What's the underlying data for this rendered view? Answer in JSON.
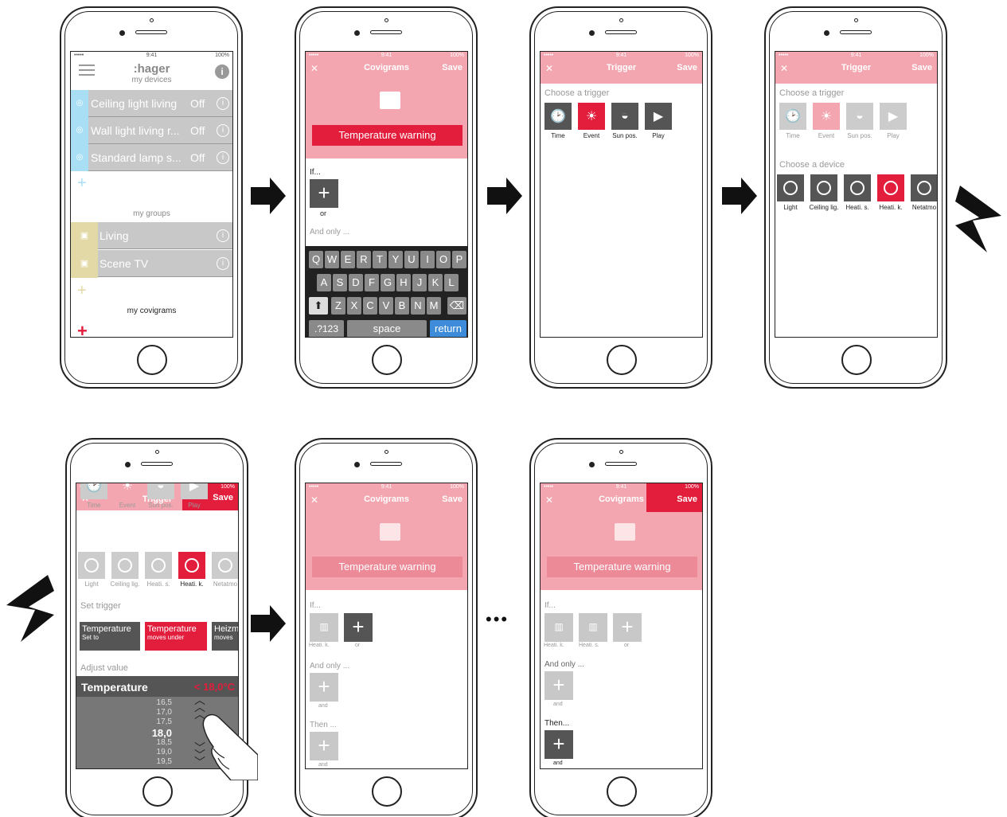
{
  "status": {
    "signal": "••••• ",
    "time": "9:41",
    "battery": "100%"
  },
  "phone1": {
    "logo": ":hager",
    "devices_title": "my devices",
    "devices": [
      {
        "label": "Ceiling light living",
        "state": "Off"
      },
      {
        "label": "Wall light living r...",
        "state": "Off"
      },
      {
        "label": "Standard lamp s...",
        "state": "Off"
      }
    ],
    "groups_title": "my groups",
    "groups": [
      {
        "label": "Living"
      },
      {
        "label": "Scene TV"
      }
    ],
    "covigrams_title": "my covigrams"
  },
  "phone2": {
    "title": "Covigrams",
    "save": "Save",
    "warning": "Temperature warning",
    "if": "If...",
    "or": "or",
    "and_only": "And only ...",
    "keys_row1": [
      "Q",
      "W",
      "E",
      "R",
      "T",
      "Y",
      "U",
      "I",
      "O",
      "P"
    ],
    "keys_row2": [
      "A",
      "S",
      "D",
      "F",
      "G",
      "H",
      "J",
      "K",
      "L"
    ],
    "keys_row3": [
      "Z",
      "X",
      "C",
      "V",
      "B",
      "N",
      "M"
    ],
    "k_num": ".?123",
    "k_space": "space",
    "k_return": "return"
  },
  "phone3": {
    "title": "Trigger",
    "save": "Save",
    "choose": "Choose a trigger",
    "triggers": [
      "Time",
      "Event",
      "Sun pos.",
      "Play"
    ]
  },
  "phone4": {
    "title": "Trigger",
    "save": "Save",
    "choose": "Choose a trigger",
    "triggers": [
      "Time",
      "Event",
      "Sun pos.",
      "Play"
    ],
    "choose_device": "Choose a device",
    "devices": [
      "Light",
      "Ceiling lig.",
      "Heati. s.",
      "Heati. k.",
      "Netatmo"
    ]
  },
  "phone5": {
    "title": "Trigger",
    "save": "Save",
    "triggers": [
      "Time",
      "Event",
      "Sun pos.",
      "Play"
    ],
    "devices": [
      "Light",
      "Ceiling lig.",
      "Heati. s.",
      "Heati. k.",
      "Netatmo"
    ],
    "set_trigger": "Set trigger",
    "opt1_t": "Temperature",
    "opt1_s": "Set to",
    "opt2_t": "Temperature",
    "opt2_s": "moves under",
    "opt3_t": "Heizm",
    "opt3_s": "moves",
    "adjust": "Adjust value",
    "temp_label": "Temperature",
    "temp_value": "< 18,0°C",
    "values": [
      "16,5",
      "17,0",
      "17,5",
      "18,0",
      "18,5",
      "19,0",
      "19,5"
    ]
  },
  "phone6": {
    "title": "Covigrams",
    "save": "Save",
    "warning": "Temperature warning",
    "if": "If...",
    "heati": "Heati. k.",
    "or": "or",
    "and_only": "And only ...",
    "and": "and",
    "then": "Then ..."
  },
  "phone7": {
    "title": "Covigrams",
    "save": "Save",
    "warning": "Temperature warning",
    "if": "If...",
    "heati1": "Heati. k.",
    "heati2": "Heati. s.",
    "or": "or",
    "and_only": "And only ...",
    "and": "and",
    "then": "Then...",
    "and2": "and"
  },
  "ellipsis": "•••",
  "colors": {
    "accent": "#e31d3c",
    "pink": "#f4a6b0",
    "blue": "#a8dff5",
    "olive": "#e3d9a6",
    "grey": "#c8c8c8",
    "dark": "#555555"
  }
}
